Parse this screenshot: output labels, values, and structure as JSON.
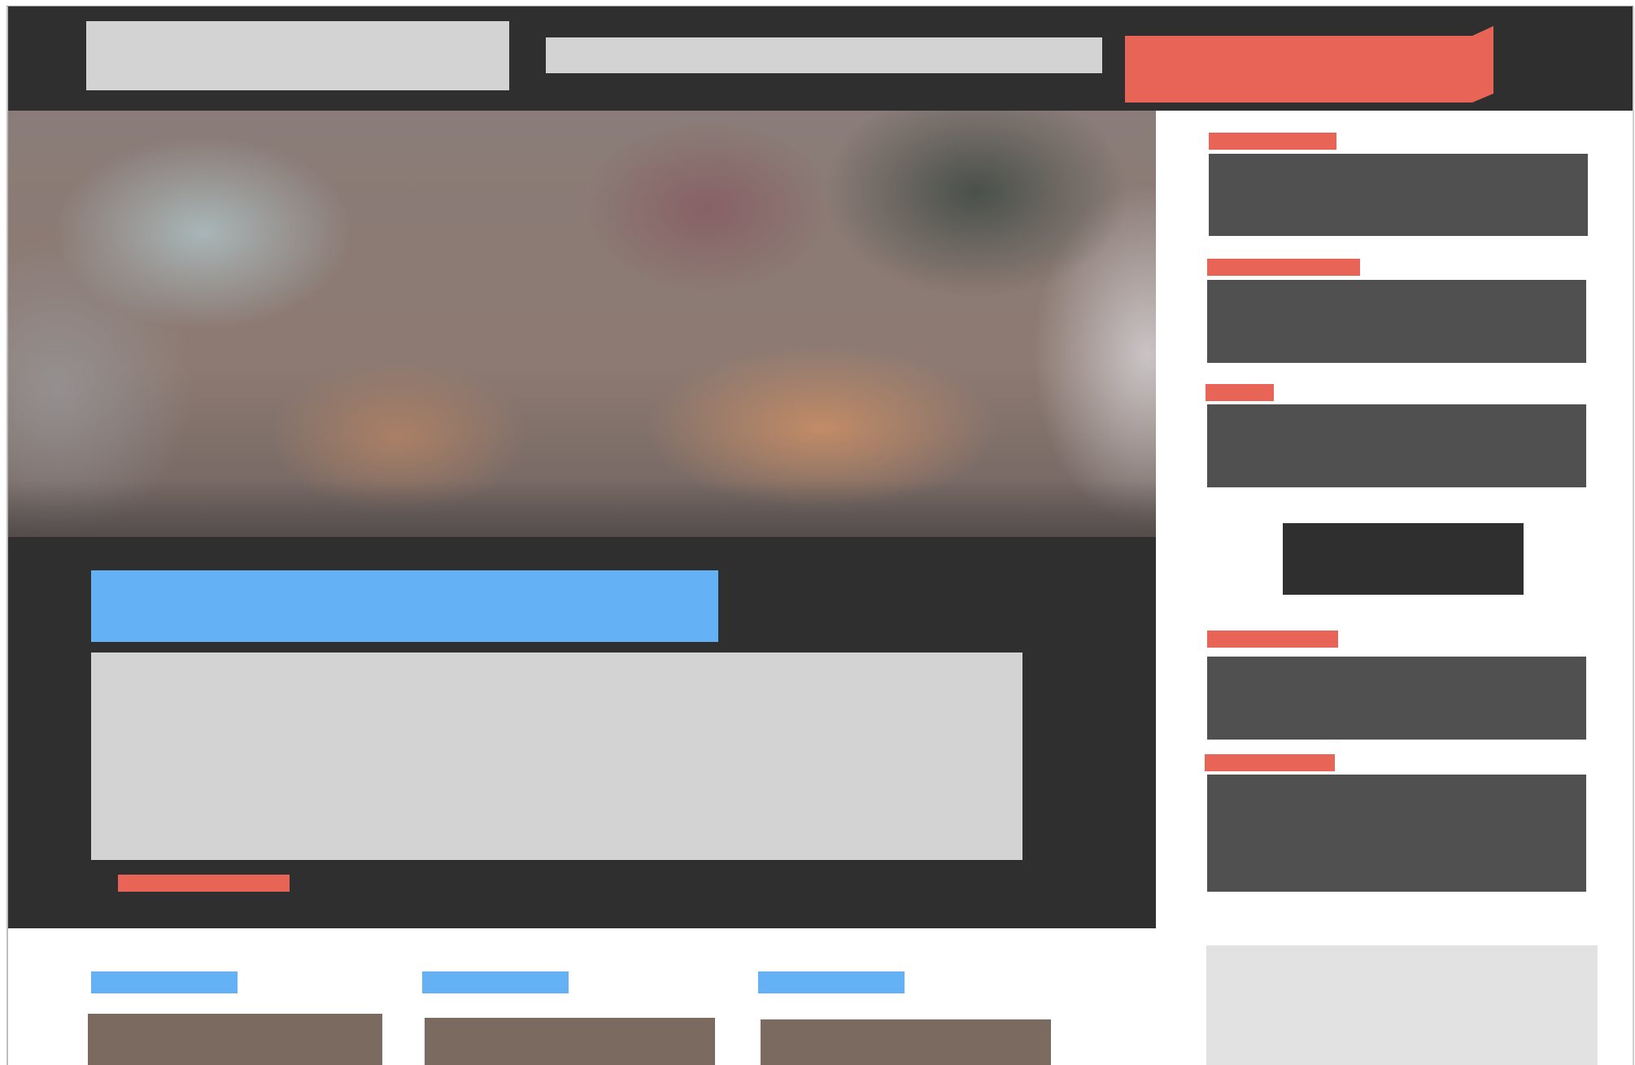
{
  "header": {
    "logo_icon": "logo-placeholder",
    "cta_icon": "ribbon-banner-icon"
  },
  "colors": {
    "dark": "#2f2f2f",
    "accent_red": "#e86456",
    "accent_blue": "#64b1f6",
    "placeholder_light": "#d3d3d3",
    "sidebar_block": "#505050",
    "thumb_brown": "#7a6a60"
  },
  "sidebar": {
    "items_count_label": "",
    "items": [
      {
        "label": ""
      },
      {
        "label": ""
      },
      {
        "label": ""
      },
      {
        "label": ""
      },
      {
        "label": ""
      }
    ],
    "button_label": ""
  },
  "feature": {
    "title": "",
    "body": "",
    "link": ""
  },
  "cards": [
    {
      "title": ""
    },
    {
      "title": ""
    },
    {
      "title": ""
    }
  ]
}
